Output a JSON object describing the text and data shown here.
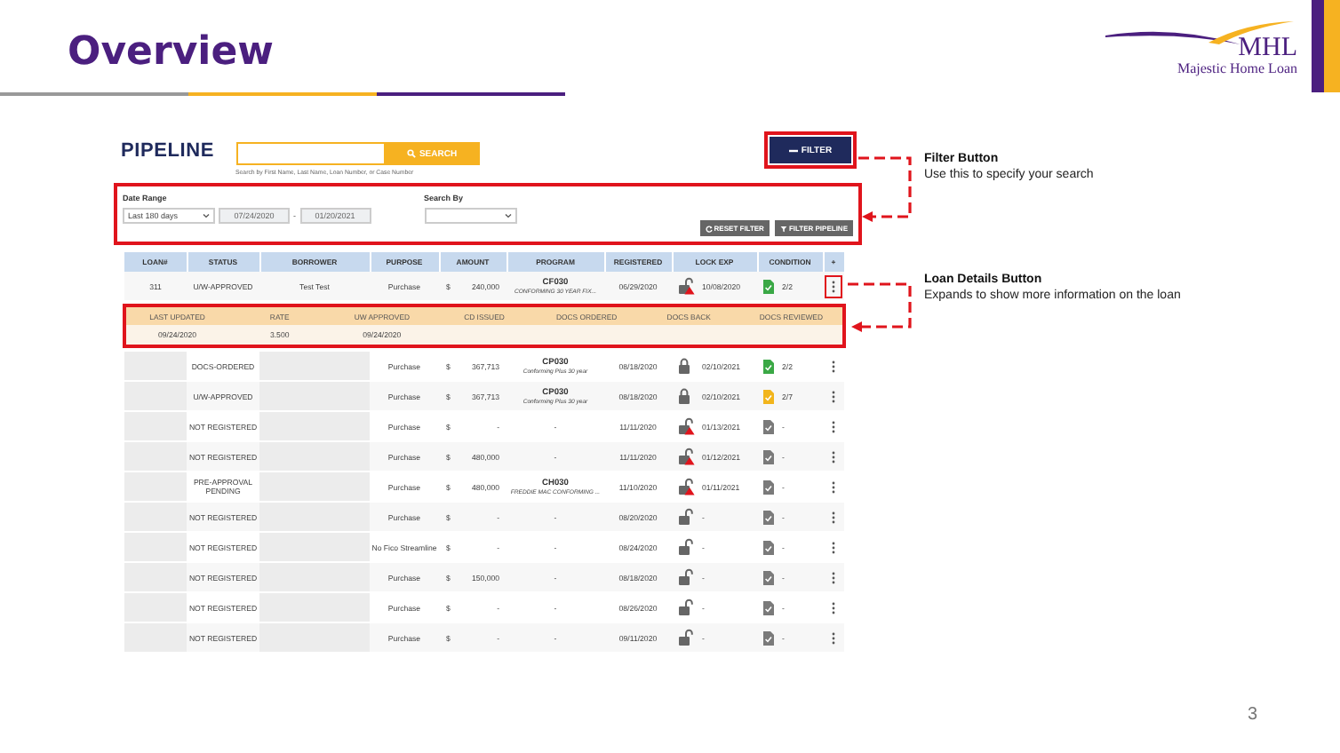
{
  "slide": {
    "title": "Overview",
    "page_number": "3"
  },
  "logo": {
    "initials": "MHL",
    "name": "Majestic Home Loan"
  },
  "pipeline": {
    "title": "PIPELINE",
    "search_button": "SEARCH",
    "search_hint": "Search by First Name, Last Name, Loan Number, or Case Number",
    "filter_button": "FILTER"
  },
  "filter_panel": {
    "date_range_label": "Date Range",
    "date_range": "Last 180 days",
    "date_from": "07/24/2020",
    "separator": "-",
    "date_to": "01/20/2021",
    "search_by_label": "Search By",
    "buttons": [
      "RESET FILTER",
      "FILTER PIPELINE"
    ]
  },
  "table": {
    "columns": [
      "LOAN#",
      "STATUS",
      "BORROWER",
      "PURPOSE",
      "AMOUNT",
      "PROGRAM",
      "REGISTERED",
      "LOCK EXP",
      "CONDITION",
      "+"
    ],
    "rows": [
      {
        "loan": "311",
        "status": "U/W-APPROVED",
        "borrower": "Test Test",
        "redacted": false,
        "purpose": "Purchase",
        "currency": "$",
        "amount": "240,000",
        "program": {
          "code": "CF030",
          "name": "CONFORMING 30 YEAR FIX..."
        },
        "registered": "06/29/2020",
        "lock": {
          "kind": "warning"
        },
        "lock_exp": "10/08/2020",
        "condition": {
          "count": "2/2",
          "color": "#3aa845"
        },
        "expanded": true,
        "details": {
          "columns": [
            "LAST UPDATED",
            "RATE",
            "UW APPROVED",
            "CD ISSUED",
            "DOCS ORDERED",
            "DOCS BACK",
            "DOCS REVIEWED"
          ],
          "values": [
            "09/24/2020",
            "3.500",
            "09/24/2020"
          ]
        }
      },
      {
        "status": "DOCS-ORDERED",
        "redacted": true,
        "purpose": "Purchase",
        "currency": "$",
        "amount": "367,713",
        "program": {
          "code": "CP030",
          "name": "Conforming Plus 30 year"
        },
        "registered": "08/18/2020",
        "lock": {
          "kind": "locked"
        },
        "lock_exp": "02/10/2021",
        "condition": {
          "count": "2/2",
          "color": "#3aa845"
        },
        "expanded": false
      },
      {
        "status": "U/W-APPROVED",
        "redacted": true,
        "purpose": "Purchase",
        "currency": "$",
        "amount": "367,713",
        "program": {
          "code": "CP030",
          "name": "Conforming Plus 30 year"
        },
        "registered": "08/18/2020",
        "lock": {
          "kind": "locked"
        },
        "lock_exp": "02/10/2021",
        "condition": {
          "count": "2/7",
          "color": "#f2b51c"
        },
        "expanded": false
      },
      {
        "status": "NOT REGISTERED",
        "redacted": true,
        "purpose": "Purchase",
        "currency": "$",
        "amount": "-",
        "program": {
          "code": "-"
        },
        "registered": "11/11/2020",
        "lock": {
          "kind": "warning"
        },
        "lock_exp": "01/13/2021",
        "condition": {
          "count": "-",
          "color": "#7a7a7a"
        },
        "expanded": false
      },
      {
        "status": "NOT REGISTERED",
        "redacted": true,
        "purpose": "Purchase",
        "currency": "$",
        "amount": "480,000",
        "program": {
          "code": "-"
        },
        "registered": "11/11/2020",
        "lock": {
          "kind": "warning"
        },
        "lock_exp": "01/12/2021",
        "condition": {
          "count": "-",
          "color": "#7a7a7a"
        },
        "expanded": false
      },
      {
        "status": "PRE-APPROVAL PENDING",
        "redacted": true,
        "purpose": "Purchase",
        "currency": "$",
        "amount": "480,000",
        "program": {
          "code": "CH030",
          "name": "FREDDIE MAC CONFORMING ..."
        },
        "registered": "11/10/2020",
        "lock": {
          "kind": "warning"
        },
        "lock_exp": "01/11/2021",
        "condition": {
          "count": "-",
          "color": "#7a7a7a"
        },
        "expanded": false
      },
      {
        "status": "NOT REGISTERED",
        "redacted": true,
        "purpose": "Purchase",
        "currency": "$",
        "amount": "-",
        "program": {
          "code": "-"
        },
        "registered": "08/20/2020",
        "lock": {
          "kind": "unlocked"
        },
        "lock_exp": "-",
        "condition": {
          "count": "-",
          "color": "#7a7a7a"
        },
        "expanded": false
      },
      {
        "status": "NOT REGISTERED",
        "redacted": true,
        "purpose": "No Fico Streamline",
        "currency": "$",
        "amount": "-",
        "program": {
          "code": "-"
        },
        "registered": "08/24/2020",
        "lock": {
          "kind": "unlocked"
        },
        "lock_exp": "-",
        "condition": {
          "count": "-",
          "color": "#7a7a7a"
        },
        "expanded": false
      },
      {
        "status": "NOT REGISTERED",
        "redacted": true,
        "purpose": "Purchase",
        "currency": "$",
        "amount": "150,000",
        "program": {
          "code": "-"
        },
        "registered": "08/18/2020",
        "lock": {
          "kind": "unlocked"
        },
        "lock_exp": "-",
        "condition": {
          "count": "-",
          "color": "#7a7a7a"
        },
        "expanded": false
      },
      {
        "status": "NOT REGISTERED",
        "redacted": true,
        "purpose": "Purchase",
        "currency": "$",
        "amount": "-",
        "program": {
          "code": "-"
        },
        "registered": "08/26/2020",
        "lock": {
          "kind": "unlocked"
        },
        "lock_exp": "-",
        "condition": {
          "count": "-",
          "color": "#7a7a7a"
        },
        "expanded": false
      },
      {
        "status": "NOT REGISTERED",
        "redacted": true,
        "purpose": "Purchase",
        "currency": "$",
        "amount": "-",
        "program": {
          "code": "-"
        },
        "registered": "09/11/2020",
        "lock": {
          "kind": "unlocked"
        },
        "lock_exp": "-",
        "condition": {
          "count": "-",
          "color": "#7a7a7a"
        },
        "expanded": false
      }
    ]
  },
  "annotations": [
    {
      "title": "Filter Button",
      "text": "Use this to specify your search"
    },
    {
      "title": "Loan Details Button",
      "text": "Expands to show more information on the loan"
    }
  ]
}
